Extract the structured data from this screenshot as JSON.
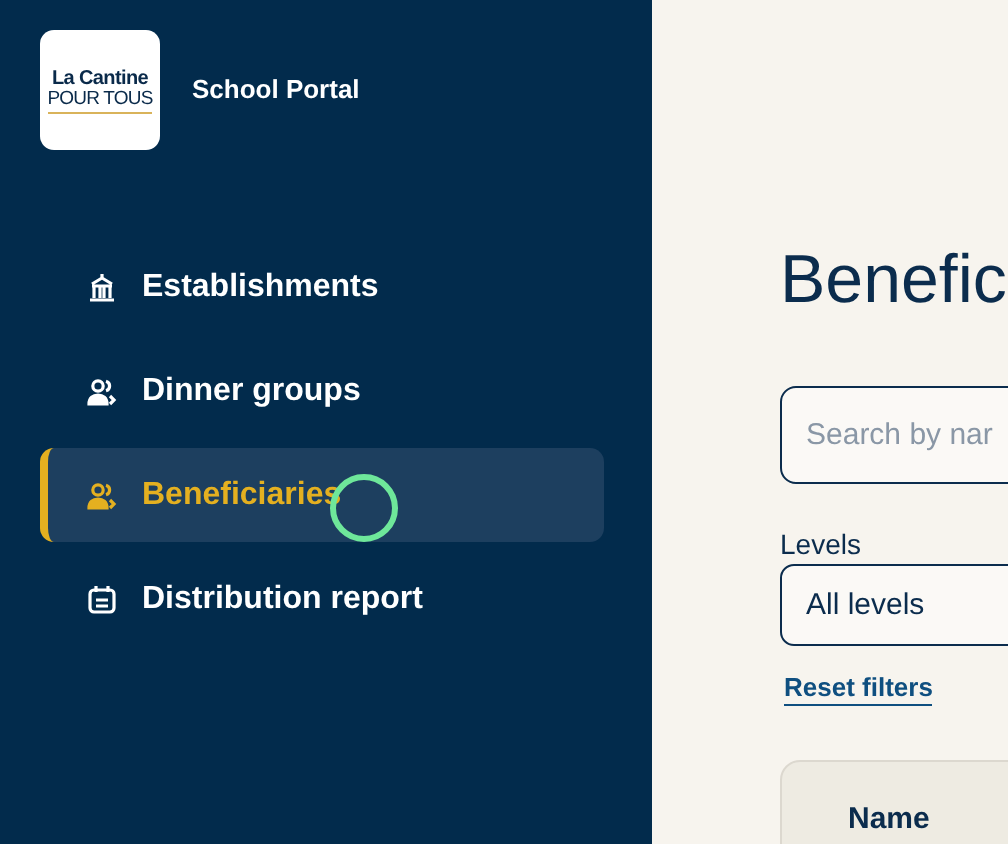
{
  "sidebar": {
    "logo": {
      "line_1": "La Cantine",
      "line_2": "POUR TOUS"
    },
    "app_name": "School Portal",
    "items": [
      {
        "label": "Establishments",
        "selected": false
      },
      {
        "label": "Dinner groups",
        "selected": false
      },
      {
        "label": "Beneficiaries",
        "selected": true
      },
      {
        "label": "Distribution report",
        "selected": false
      }
    ]
  },
  "main": {
    "title": "Benefic",
    "search": {
      "placeholder": "Search by nar"
    },
    "levels": {
      "label": "Levels",
      "value": "All levels"
    },
    "reset": "Reset filters",
    "table": {
      "columns": [
        "Name"
      ]
    }
  }
}
